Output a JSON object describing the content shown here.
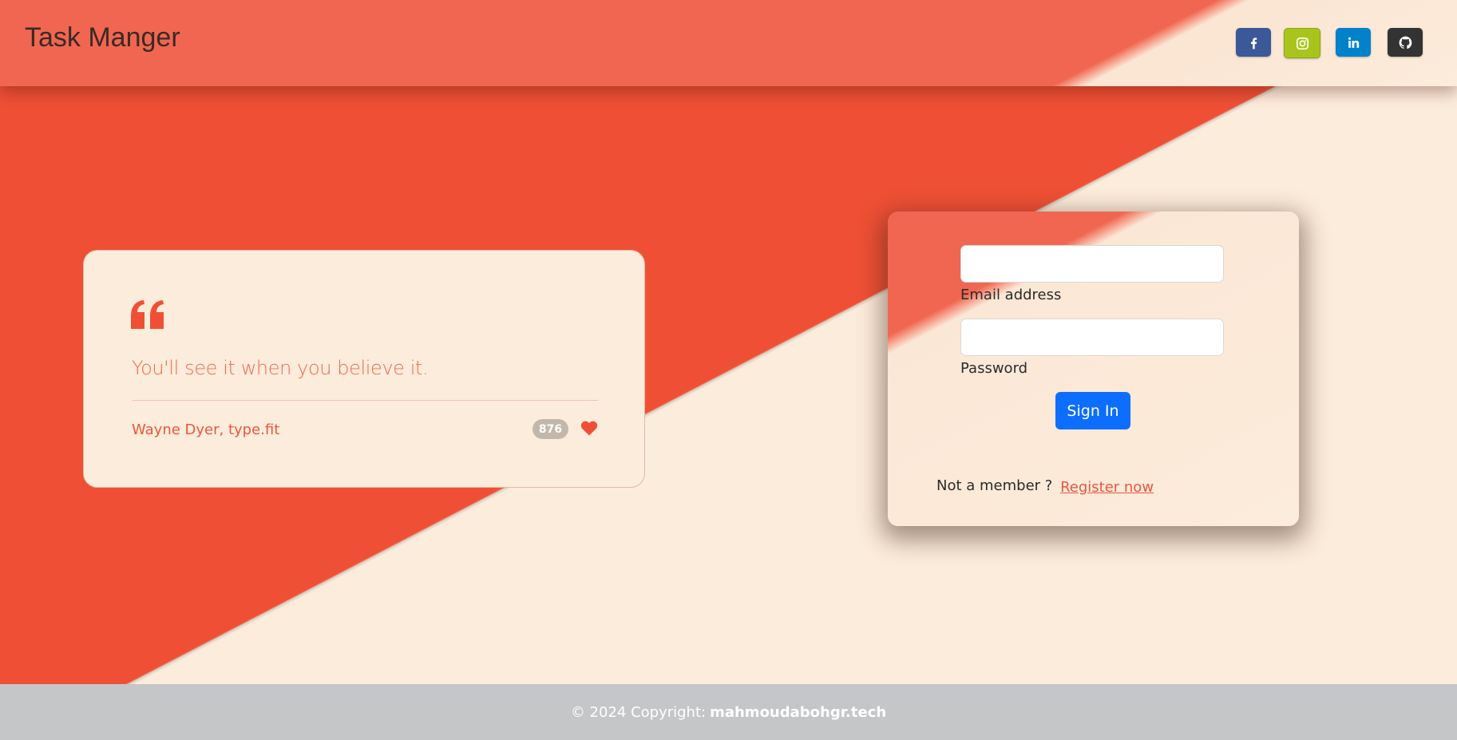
{
  "navbar": {
    "brand": "Task Manger",
    "social": [
      {
        "name": "facebook",
        "icon": "facebook-icon",
        "color": "#3b5998"
      },
      {
        "name": "instagram",
        "icon": "instagram-icon",
        "color": "#a9c51d"
      },
      {
        "name": "linkedin",
        "icon": "linkedin-icon",
        "color": "#0082ca"
      },
      {
        "name": "github",
        "icon": "github-icon",
        "color": "#333333"
      }
    ]
  },
  "quote": {
    "icon": "quote-left-icon",
    "text": "You'll see it when you believe it.",
    "author": "Wayne Dyer, type.fit",
    "likes": "876",
    "like_icon": "heart-icon"
  },
  "login": {
    "email_value": "",
    "email_label": "Email address",
    "password_value": "",
    "password_label": "Password",
    "submit_label": "Sign In",
    "not_member_text": "Not a member ?",
    "register_link": "Register now"
  },
  "footer": {
    "copyright_prefix": "© 2024 Copyright:",
    "site": "mahmoudabohgr.tech"
  },
  "colors": {
    "accent": "#ef5035",
    "cream": "#fcecdb",
    "primary_button": "#0d6efd",
    "footer_bg": "#c5c6c8"
  }
}
